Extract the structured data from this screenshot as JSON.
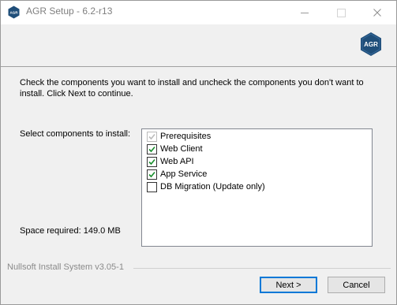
{
  "window": {
    "title": "AGR Setup - 6.2-r13",
    "icon": "agr-logo",
    "controls": [
      "minimize-icon",
      "maximize-icon",
      "close-icon"
    ]
  },
  "header": {
    "logo": "agr-logo",
    "logo_text": "AGR"
  },
  "body": {
    "intro": "Check the components you want to install and uncheck the components you don't want to install. Click Next to continue.",
    "select_label": "Select components to install:",
    "space_label": "Space required: 149.0 MB",
    "components": [
      {
        "label": "Prerequisites",
        "checked": true,
        "disabled": true
      },
      {
        "label": "Web Client",
        "checked": true,
        "disabled": false
      },
      {
        "label": "Web API",
        "checked": true,
        "disabled": false
      },
      {
        "label": "App Service",
        "checked": true,
        "disabled": false
      },
      {
        "label": "DB Migration (Update only)",
        "checked": false,
        "disabled": false
      }
    ]
  },
  "footer": {
    "branding": "Nullsoft Install System v3.05-1",
    "next_label": "Next >",
    "cancel_label": "Cancel"
  },
  "colors": {
    "logo": "#1f4e79",
    "checkmark": "#1a8f2e",
    "disabled_check": "#bcbcbc",
    "focus": "#0078d7"
  }
}
